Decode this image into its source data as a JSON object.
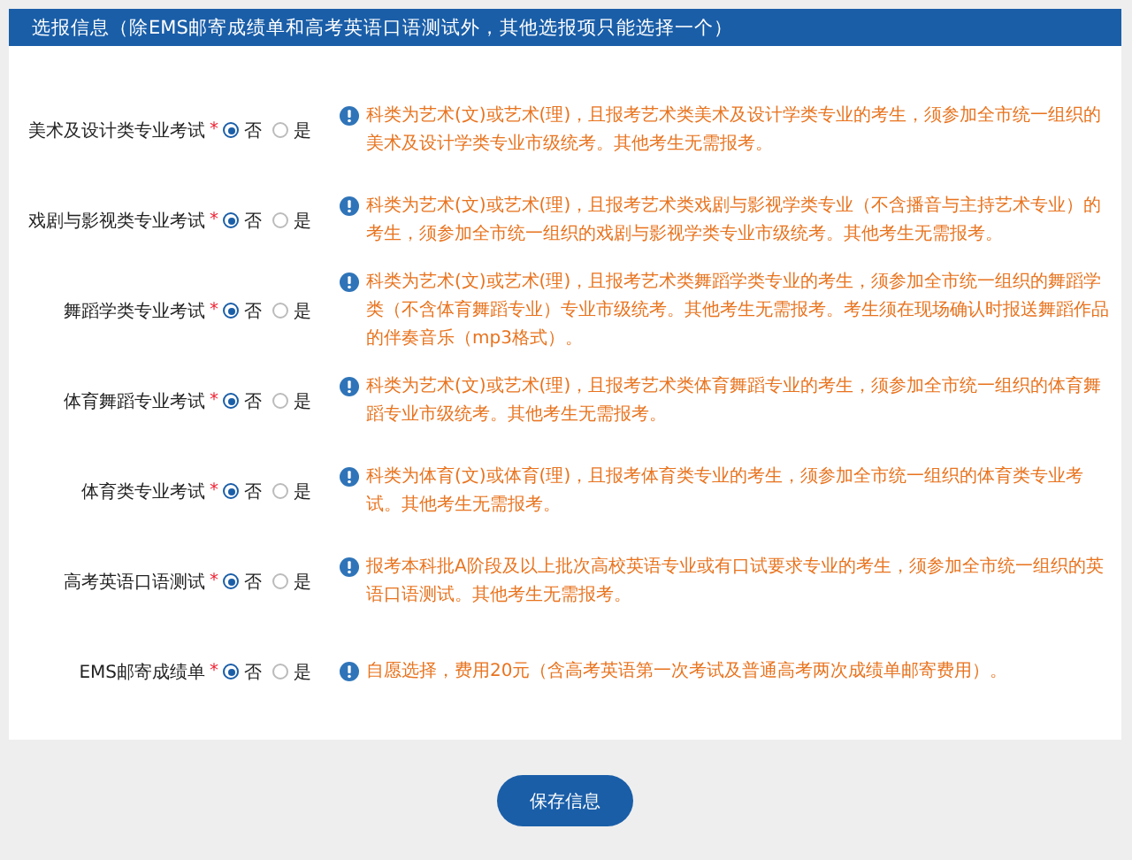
{
  "header": {
    "title": "选报信息（除EMS邮寄成绩单和高考英语口语测试外，其他选报项只能选择一个）"
  },
  "items": [
    {
      "label": "美术及设计类专业考试",
      "required": "*",
      "options": [
        {
          "label": "否",
          "selected": true
        },
        {
          "label": "是",
          "selected": false
        }
      ],
      "note": "科类为艺术(文)或艺术(理)，且报考艺术类美术及设计学类专业的考生，须参加全市统一组织的美术及设计学类专业市级统考。其他考生无需报考。"
    },
    {
      "label": "戏剧与影视类专业考试",
      "required": "*",
      "options": [
        {
          "label": "否",
          "selected": true
        },
        {
          "label": "是",
          "selected": false
        }
      ],
      "note": "科类为艺术(文)或艺术(理)，且报考艺术类戏剧与影视学类专业（不含播音与主持艺术专业）的考生，须参加全市统一组织的戏剧与影视学类专业市级统考。其他考生无需报考。"
    },
    {
      "label": "舞蹈学类专业考试",
      "required": "*",
      "options": [
        {
          "label": "否",
          "selected": true
        },
        {
          "label": "是",
          "selected": false
        }
      ],
      "note": "科类为艺术(文)或艺术(理)，且报考艺术类舞蹈学类专业的考生，须参加全市统一组织的舞蹈学类（不含体育舞蹈专业）专业市级统考。其他考生无需报考。考生须在现场确认时报送舞蹈作品的伴奏音乐（mp3格式）。"
    },
    {
      "label": "体育舞蹈专业考试",
      "required": "*",
      "options": [
        {
          "label": "否",
          "selected": true
        },
        {
          "label": "是",
          "selected": false
        }
      ],
      "note": "科类为艺术(文)或艺术(理)，且报考艺术类体育舞蹈专业的考生，须参加全市统一组织的体育舞蹈专业市级统考。其他考生无需报考。"
    },
    {
      "label": "体育类专业考试",
      "required": "*",
      "options": [
        {
          "label": "否",
          "selected": true
        },
        {
          "label": "是",
          "selected": false
        }
      ],
      "note": "科类为体育(文)或体育(理)，且报考体育类专业的考生，须参加全市统一组织的体育类专业考试。其他考生无需报考。"
    },
    {
      "label": "高考英语口语测试",
      "required": "*",
      "options": [
        {
          "label": "否",
          "selected": true
        },
        {
          "label": "是",
          "selected": false
        }
      ],
      "note": "报考本科批A阶段及以上批次高校英语专业或有口试要求专业的考生，须参加全市统一组织的英语口语测试。其他考生无需报考。"
    },
    {
      "label": "EMS邮寄成绩单",
      "required": "*",
      "options": [
        {
          "label": "否",
          "selected": true
        },
        {
          "label": "是",
          "selected": false
        }
      ],
      "note": "自愿选择，费用20元（含高考英语第一次考试及普通高考两次成绩单邮寄费用）。"
    }
  ],
  "save_button": "保存信息"
}
